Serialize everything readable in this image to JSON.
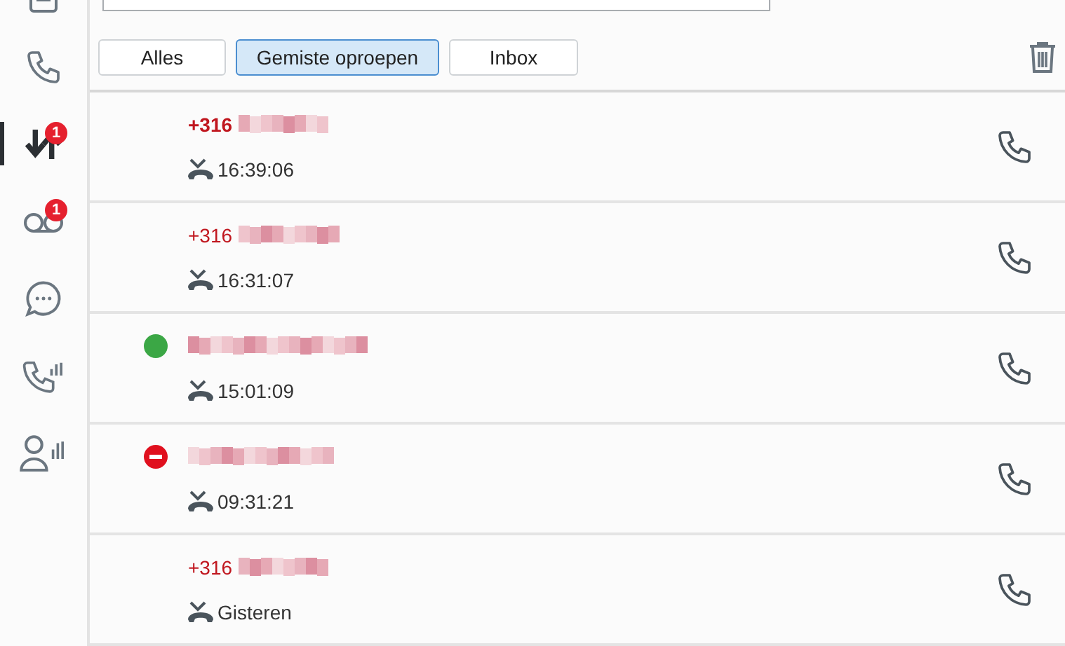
{
  "sidebar": {
    "items": [
      {
        "selected": false
      },
      {
        "selected": false
      },
      {
        "selected": true,
        "badge": "1"
      },
      {
        "selected": false,
        "badge": "1"
      },
      {
        "selected": false
      },
      {
        "selected": false
      },
      {
        "selected": false
      }
    ]
  },
  "filters": [
    {
      "label": "Alles",
      "selected": false
    },
    {
      "label": "Gemiste oproepen",
      "selected": true
    },
    {
      "label": "Inbox",
      "selected": false
    }
  ],
  "calls": [
    {
      "kind": "number",
      "caller": "+316",
      "time": "16:39:06",
      "bold": true
    },
    {
      "kind": "number",
      "caller": "+316",
      "time": "16:31:07",
      "bold": false
    },
    {
      "kind": "available",
      "time": "15:01:09"
    },
    {
      "kind": "busy",
      "time": "09:31:21"
    },
    {
      "kind": "number",
      "caller": "+316",
      "time": "Gisteren",
      "bold": false
    }
  ]
}
